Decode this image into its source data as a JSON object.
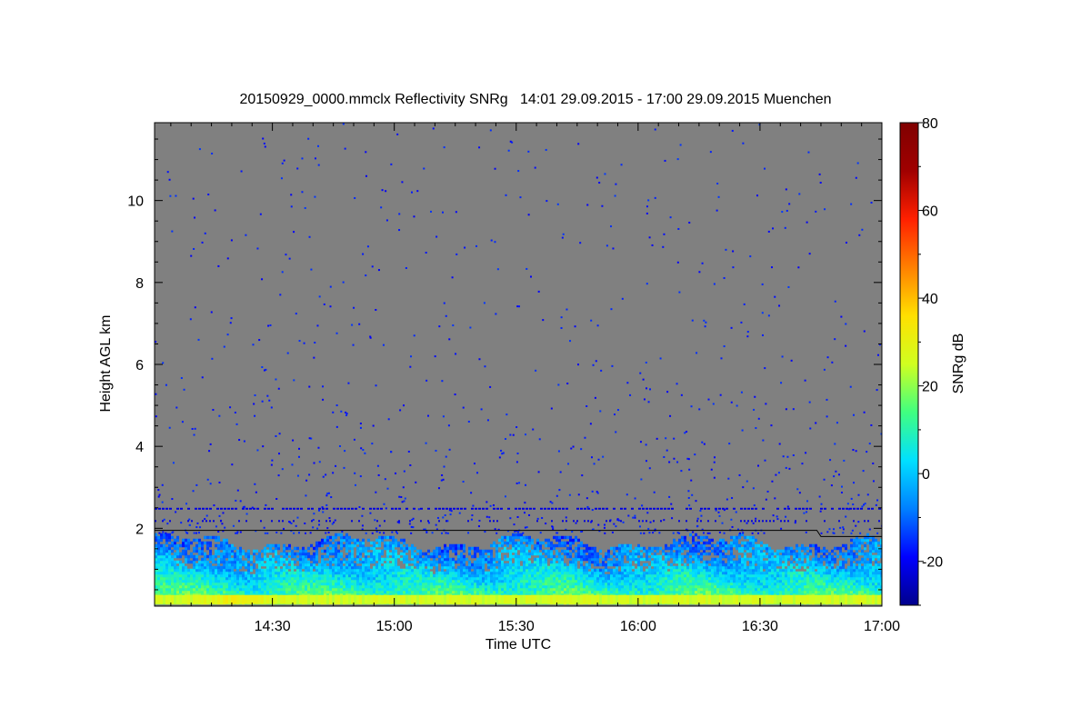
{
  "chart_data": {
    "type": "heatmap",
    "title": "20150929_0000.mmclx Reflectivity SNRg   14:01 29.09.2015 - 17:00 29.09.2015 Muenchen",
    "xlabel": "Time UTC",
    "ylabel": "Height AGL km",
    "x_range_minutes": [
      841,
      1020
    ],
    "x_ticks": [
      {
        "minute": 870,
        "label": "14:30"
      },
      {
        "minute": 900,
        "label": "15:00"
      },
      {
        "minute": 930,
        "label": "15:30"
      },
      {
        "minute": 960,
        "label": "16:00"
      },
      {
        "minute": 990,
        "label": "16:30"
      },
      {
        "minute": 1020,
        "label": "17:00"
      }
    ],
    "ylim": [
      0.1,
      11.9
    ],
    "y_ticks": [
      2,
      4,
      6,
      8,
      10
    ],
    "colorbar": {
      "label": "SNRg dB",
      "range": [
        -30,
        80
      ],
      "ticks": [
        -20,
        0,
        20,
        40,
        60,
        80
      ],
      "colors": [
        "#00008c",
        "#0000ff",
        "#0080ff",
        "#00e0ff",
        "#40ff80",
        "#d0ff20",
        "#ffe000",
        "#ff8000",
        "#ff2000",
        "#a00000",
        "#800000"
      ]
    },
    "background_color": "#808080",
    "grid": false,
    "legend": "colorbar-right",
    "cloud_layer": {
      "base_km": 0.15,
      "top_km": 1.85,
      "snr_near_surface_db": 20,
      "snr_at_top_db": -10
    },
    "boundary_line_km": [
      {
        "minute": 841,
        "height": 1.95
      },
      {
        "minute": 1004,
        "height": 1.95
      },
      {
        "minute": 1005,
        "height": 1.8
      },
      {
        "minute": 1020,
        "height": 1.8
      }
    ]
  }
}
